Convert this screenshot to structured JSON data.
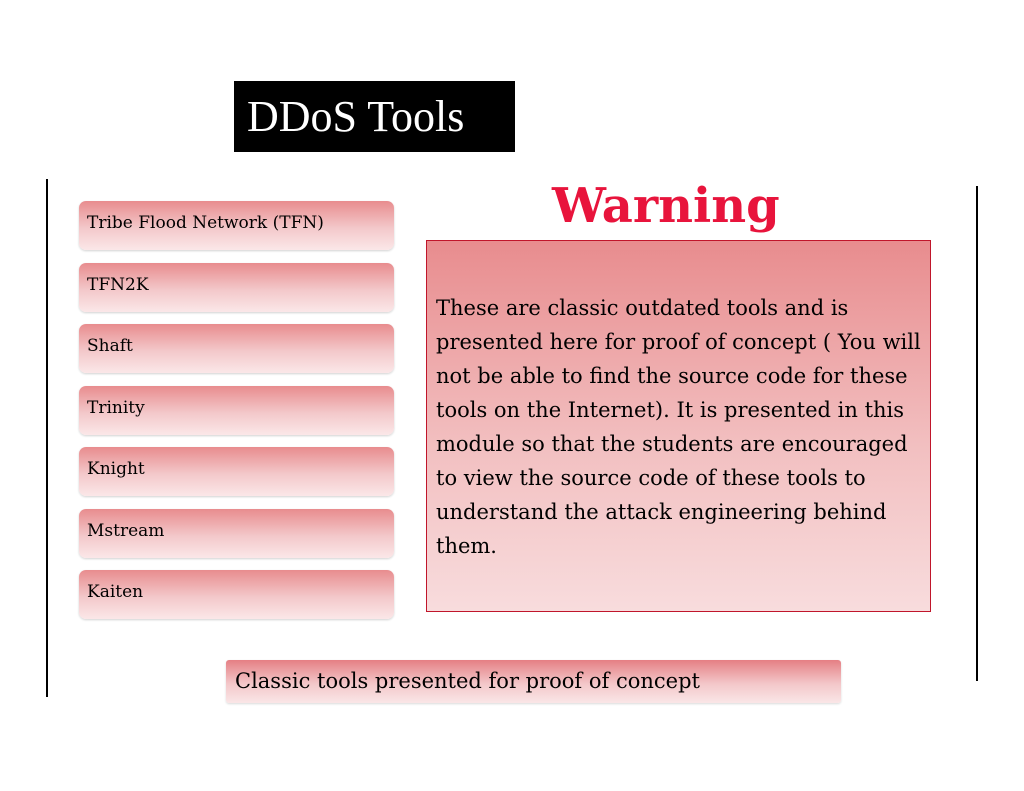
{
  "title": "DDoS Tools",
  "tools": [
    "Tribe Flood Network (TFN)",
    "TFN2K",
    "Shaft",
    "Trinity",
    "Knight",
    "Mstream",
    "Kaiten"
  ],
  "warning": {
    "heading": "Warning",
    "text": "These are classic outdated tools and is presented here for proof of concept ( You will not be able to find the source code for these tools on the Internet). It is presented in this module so that the students are encouraged to view the source code of these tools to understand the attack engineering behind them."
  },
  "footer": "Classic tools presented for proof of concept",
  "colors": {
    "warning_heading": "#e8143c",
    "box_border": "#c0162b",
    "panel_top": "#e88c8e",
    "panel_bottom": "#fbe7e8"
  }
}
